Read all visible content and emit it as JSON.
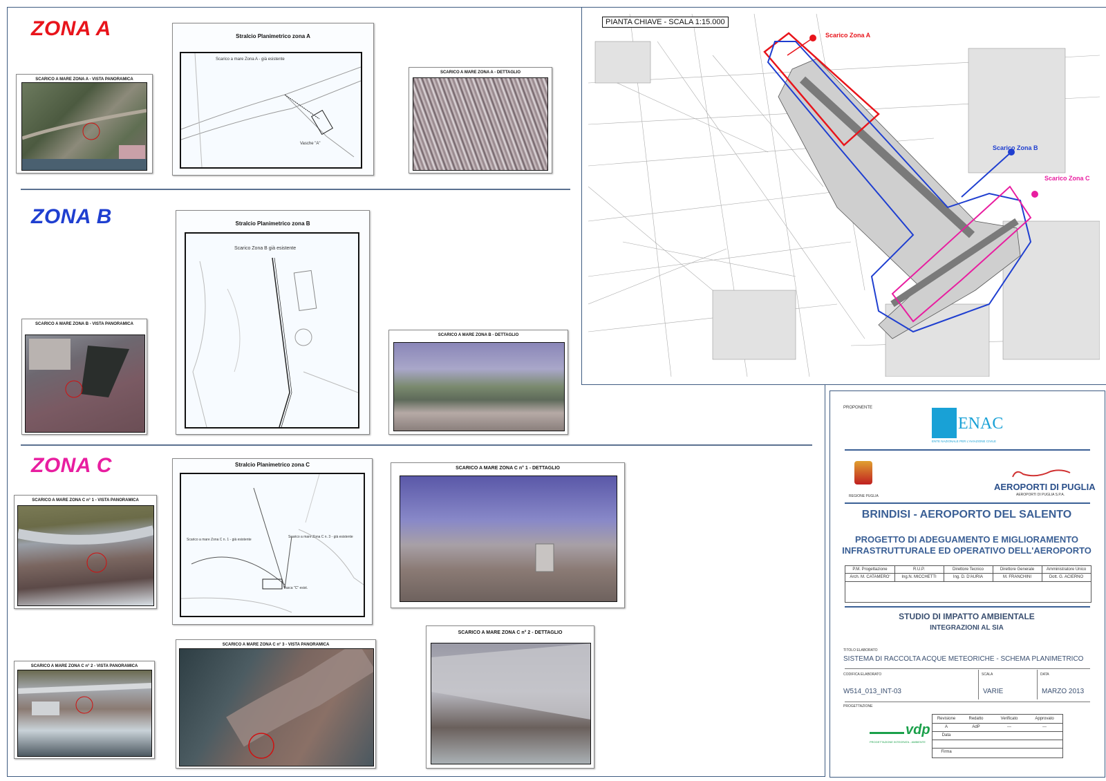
{
  "zones": {
    "a": {
      "title": "ZONA A",
      "color": "#e8141b"
    },
    "b": {
      "title": "ZONA B",
      "color": "#1f3fd0"
    },
    "c": {
      "title": "ZONA C",
      "color": "#e81ea0"
    }
  },
  "captions": {
    "a_panoramic": "SCARICO A MARE ZONA A - VISTA PANORAMICA",
    "a_plan": "Stralcio Planimetrico zona A",
    "a_detail": "SCARICO A MARE ZONA A - DETTAGLIO",
    "b_panoramic": "SCARICO A MARE ZONA B - VISTA PANORAMICA",
    "b_plan": "Stralcio Planimetrico zona B",
    "b_detail": "SCARICO A MARE ZONA B - DETTAGLIO",
    "c1_panoramic": "SCARICO A MARE ZONA C n° 1 - VISTA PANORAMICA",
    "c_plan": "Stralcio Planimetrico zona C",
    "c1_detail": "SCARICO A MARE ZONA C n° 1 - DETTAGLIO",
    "c2_panoramic": "SCARICO A MARE ZONA C n° 2 - VISTA PANORAMICA",
    "c3_panoramic": "SCARICO A MARE ZONA C n° 3 - VISTA PANORAMICA",
    "c2_detail": "SCARICO A MARE ZONA C n° 2 - DETTAGLIO"
  },
  "plan_labels": {
    "a_existing": "Scarico a mare  Zona A - già esistente",
    "a_tanks": "Vasche \"A\"",
    "b_existing": "Scarico Zona B già esistente",
    "c_existing_1": "Scarico a mare Zona C n. 1 - già esistente",
    "c_existing_2": "Scarico a mare Zona C n. 3 - già esistente",
    "c_tank": "Vasca \"C\" esist."
  },
  "key_map": {
    "title": "PIANTA CHIAVE - SCALA 1:15.000",
    "label_a": "Scarico Zona A",
    "label_b": "Scarico Zona B",
    "label_c": "Scarico Zona C",
    "color_a": "#e8141b",
    "color_b": "#1f3fd0",
    "color_c": "#e81ea0"
  },
  "title_block": {
    "proponente": "PROPONENTE",
    "enac_logo": "ENAC",
    "enac_sub": "ENTE NAZIONALE PER L'AVIAZIONE CIVILE",
    "regione": "REGIONE PUGLIA",
    "aeroporti": "AEROPORTI DI PUGLIA",
    "aeroporti_sub": "AEROPORTI DI PUGLIA S.P.A.",
    "airport": "BRINDISI - AEROPORTO DEL SALENTO",
    "project_line1": "PROGETTO DI ADEGUAMENTO E MIGLIORAMENTO",
    "project_line2": "INFRASTRUTTURALE ED OPERATIVO DELL'AEROPORTO",
    "roles": [
      "P.M. Progettazione",
      "R.U.P.",
      "Direttore Tecnico",
      "Direttore Generale",
      "Amministratore Unico"
    ],
    "names": [
      "Arch. M. CATAMERO'",
      "Ing.N. MICCHETTI",
      "Ing. D. D'AURIA",
      "M. FRANCHINI",
      "Dott. G. ACIERNO"
    ],
    "study_title": "STUDIO DI IMPATTO AMBIENTALE",
    "study_sub": "INTEGRAZIONI AL SIA",
    "doc_title_label": "TITOLO ELABORATO",
    "doc_title": "SISTEMA DI RACCOLTA ACQUE METEORICHE - SCHEMA PLANIMETRICO",
    "code_label": "CODIFICA ELABORATO",
    "code": "W514_013_INT-03",
    "scale_label": "SCALA",
    "scale": "VARIE",
    "date_label": "DATA",
    "date": "MARZO 2013",
    "design_label": "PROGETTAZIONE",
    "vdp_logo": "vdp",
    "vdp_sub": "PROGETTAZIONE INTEGRATA - AMBIENTE",
    "rev_headers": [
      "Revisione",
      "Redatto",
      "Verificato",
      "Approvato"
    ],
    "rev_row": [
      "A",
      "AdP",
      "---",
      "---"
    ],
    "rev_data": "Data",
    "rev_firma": "Firma"
  }
}
